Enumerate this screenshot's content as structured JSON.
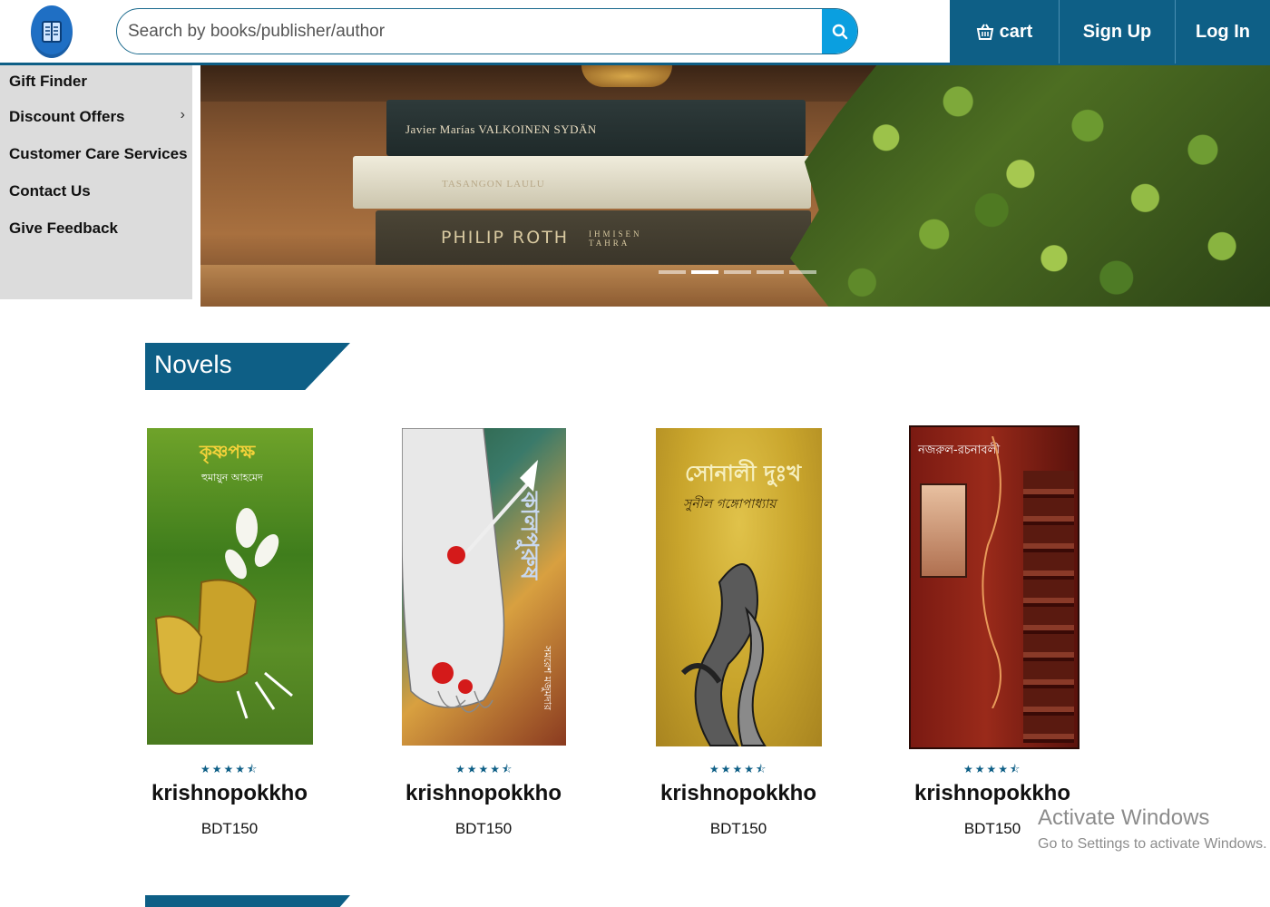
{
  "header": {
    "search_placeholder": "Search by books/publisher/author",
    "nav": {
      "cart": "cart",
      "sign_up": "Sign Up",
      "log_in": "Log In"
    }
  },
  "sidebar": {
    "items": [
      {
        "label": "Gift Finder"
      },
      {
        "label": "Discount Offers"
      },
      {
        "label": "Customer Care Services"
      },
      {
        "label": "Contact Us"
      },
      {
        "label": "Give Feedback"
      }
    ]
  },
  "banner": {
    "book_spines": [
      "Javier Marías   VALKOINEN SYDÄN",
      "TASANGON LAULU",
      "PHILIP ROTH"
    ],
    "book_spine_small": "IHMISEN TAHRA",
    "slides": 5,
    "active_slide": 2
  },
  "section": {
    "title": "Novels"
  },
  "books": [
    {
      "title": "krishnopokkho",
      "price": "BDT150",
      "rating": 4.5,
      "cover_text": "কৃষ্ণপক্ষ",
      "cover_sub": "হুমায়ুন আহমেদ"
    },
    {
      "title": "krishnopokkho",
      "price": "BDT150",
      "rating": 4.5,
      "cover_text": "কালপুরুষ",
      "cover_sub": "সমরেশ মজুমদার"
    },
    {
      "title": "krishnopokkho",
      "price": "BDT150",
      "rating": 4.5,
      "cover_text": "সোনালী দুঃখ",
      "cover_sub": "সুনীল গঙ্গোপাধ্যায়"
    },
    {
      "title": "krishnopokkho",
      "price": "BDT150",
      "rating": 4.5,
      "cover_text": "নজরুল-রচনাবলী",
      "cover_sub": ""
    }
  ],
  "watermark": {
    "line1": "Activate Windows",
    "line2": "Go to Settings to activate Windows."
  },
  "colors": {
    "brand": "#0e5f86",
    "search_button": "#0a9fe0",
    "sidebar_bg": "#dcdcdc"
  }
}
